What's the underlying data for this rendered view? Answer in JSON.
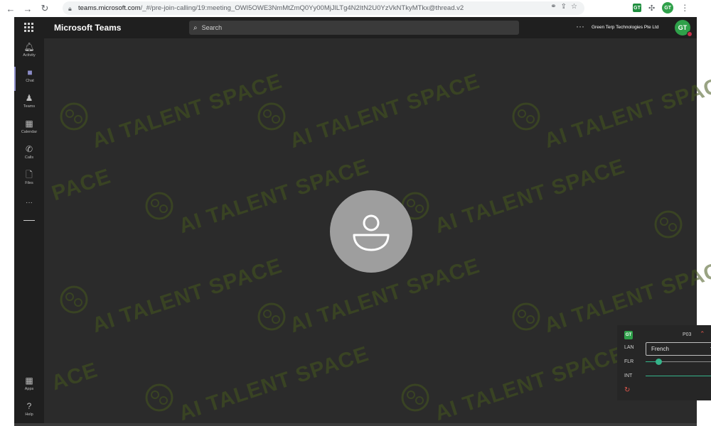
{
  "browser": {
    "url_host": "teams.microsoft.com",
    "url_path": "/_#/pre-join-calling/19:meeting_OWI5OWE3NmMtZmQ0Yy00MjJlLTg4N2ItN2U0YzVkNTkyMTkx@thread.v2",
    "profile_initials": "GT",
    "extension_initials": "GT"
  },
  "header": {
    "app_title": "Microsoft Teams",
    "search_placeholder": "Search",
    "more_label": "···",
    "org_name": "Green Terp Technologies Pte Ltd",
    "avatar_initials": "GT"
  },
  "sidebar": {
    "items": [
      {
        "label": "Activity",
        "icon": "bell-icon"
      },
      {
        "label": "Chat",
        "icon": "chat-icon"
      },
      {
        "label": "Teams",
        "icon": "teams-icon"
      },
      {
        "label": "Calendar",
        "icon": "calendar-icon"
      },
      {
        "label": "Calls",
        "icon": "phone-icon"
      },
      {
        "label": "Files",
        "icon": "file-icon"
      }
    ],
    "more_label": "···",
    "bottom_items": [
      {
        "label": "Apps",
        "icon": "apps-icon"
      },
      {
        "label": "Help",
        "icon": "help-icon"
      }
    ]
  },
  "watermark": {
    "text": "AI TALENT SPACE",
    "short_a": "PACE",
    "short_b": "ACE"
  },
  "widget": {
    "logo_initials": "GT",
    "code": "P03",
    "lan_label": "LAN",
    "language_value": "French",
    "flr_label": "FLR",
    "flr_level": 0.14,
    "int_label": "INT",
    "int_level": 1.0
  },
  "colors": {
    "accent": "#8b8cc7",
    "brand_green": "#2fa04a",
    "slider_green": "#35b48a",
    "alert_red": "#e2574c"
  }
}
